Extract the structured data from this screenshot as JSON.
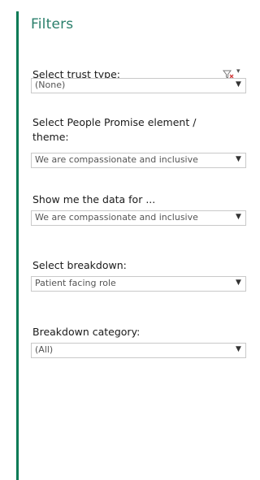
{
  "panel": {
    "title": "Filters"
  },
  "filters": [
    {
      "label": "Select trust type:",
      "value": "(None)"
    },
    {
      "label": "Select People Promise element / theme:",
      "value": "We are compassionate and inclusive"
    },
    {
      "label": "Show me the data for ...",
      "value": "We are compassionate and inclusive"
    },
    {
      "label": "Select breakdown:",
      "value": "Patient facing role"
    },
    {
      "label": "Breakdown category:",
      "value": "(All)"
    }
  ],
  "icons": {
    "clear_filter": "filter-clear-icon",
    "dropdown": "chevron-down-icon"
  },
  "colors": {
    "accent": "#087a55",
    "title": "#2a7f6b"
  }
}
